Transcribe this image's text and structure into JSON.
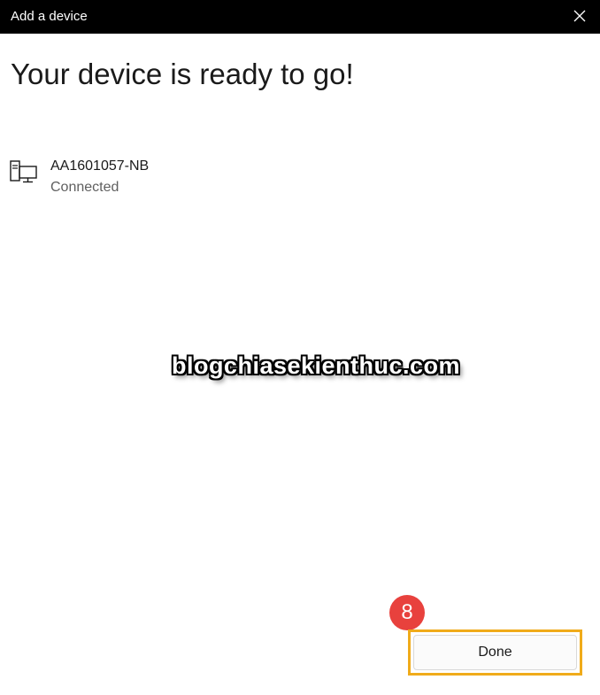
{
  "window": {
    "title": "Add a device"
  },
  "main": {
    "heading": "Your device is ready to go!"
  },
  "device": {
    "name": "AA1601057-NB",
    "status": "Connected",
    "icon": "network-device-icon"
  },
  "watermark": {
    "text": "blogchiasekienthuc.com"
  },
  "annotation": {
    "step_number": "8"
  },
  "footer": {
    "done_label": "Done"
  },
  "colors": {
    "titlebar_bg": "#000000",
    "badge_red": "#e8413d",
    "highlight_orange": "#f0ab1a"
  }
}
